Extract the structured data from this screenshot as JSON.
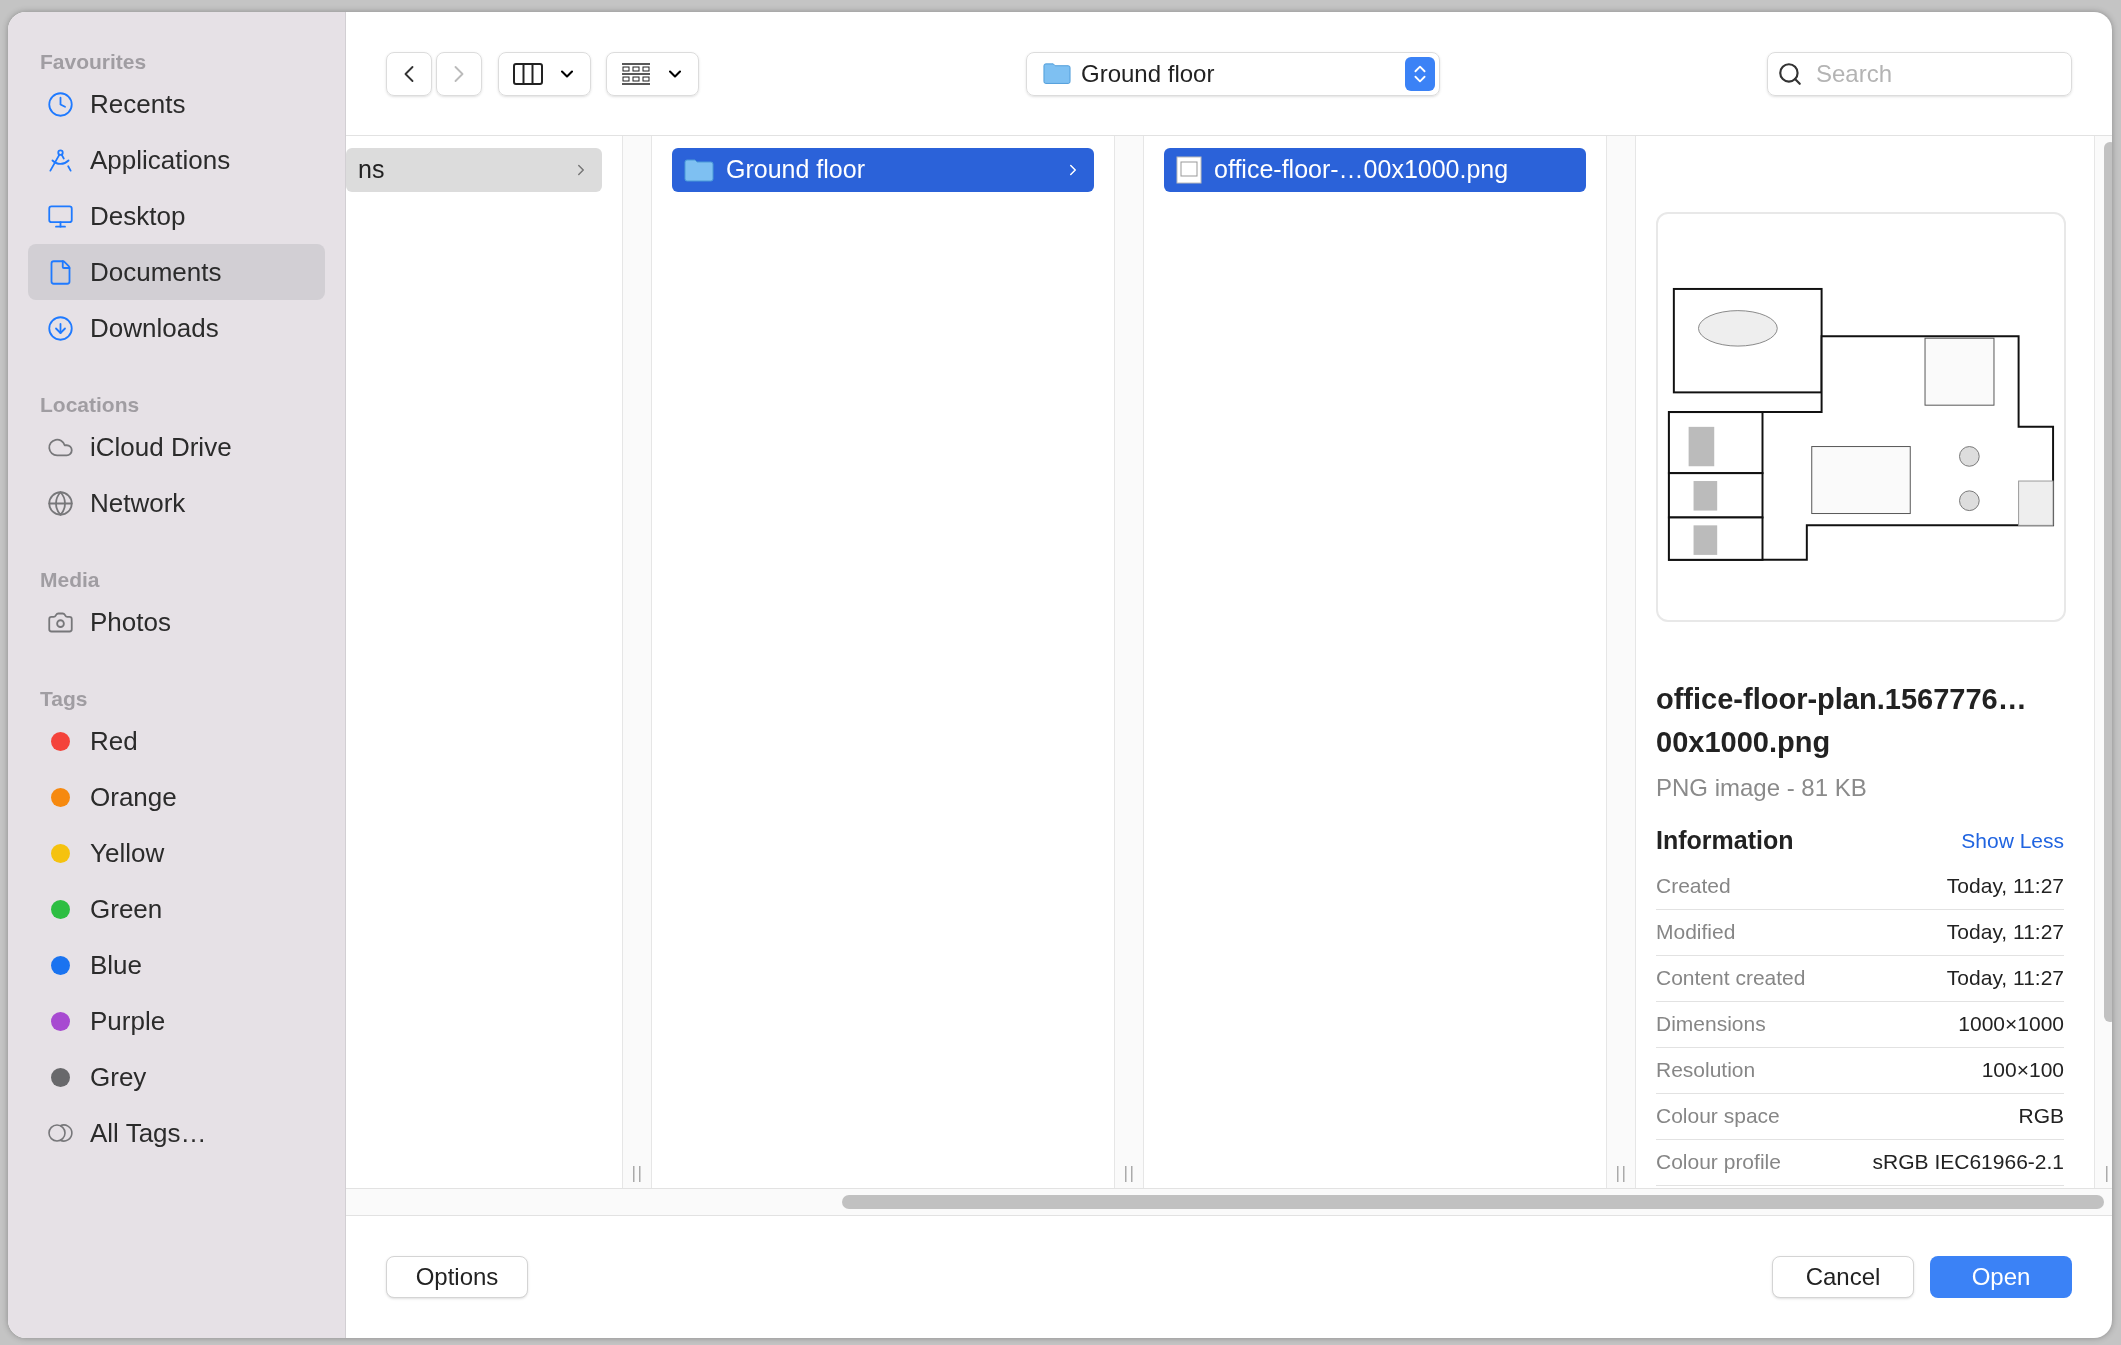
{
  "sidebar": {
    "sections": [
      {
        "title": "Favourites",
        "items": [
          {
            "label": "Recents",
            "kind": "place",
            "selected": false
          },
          {
            "label": "Applications",
            "kind": "place",
            "selected": false
          },
          {
            "label": "Desktop",
            "kind": "place",
            "selected": false
          },
          {
            "label": "Documents",
            "kind": "place",
            "selected": true
          },
          {
            "label": "Downloads",
            "kind": "place",
            "selected": false
          }
        ]
      },
      {
        "title": "Locations",
        "items": [
          {
            "label": "iCloud Drive",
            "kind": "place",
            "selected": false
          },
          {
            "label": "Network",
            "kind": "place",
            "selected": false
          }
        ]
      },
      {
        "title": "Media",
        "items": [
          {
            "label": "Photos",
            "kind": "place",
            "selected": false
          }
        ]
      },
      {
        "title": "Tags",
        "items": [
          {
            "label": "Red",
            "kind": "tag",
            "color": "#f4433b",
            "selected": false
          },
          {
            "label": "Orange",
            "kind": "tag",
            "color": "#f6890f",
            "selected": false
          },
          {
            "label": "Yellow",
            "kind": "tag",
            "color": "#f5c20f",
            "selected": false
          },
          {
            "label": "Green",
            "kind": "tag",
            "color": "#2dbe42",
            "selected": false
          },
          {
            "label": "Blue",
            "kind": "tag",
            "color": "#1a73f0",
            "selected": false
          },
          {
            "label": "Purple",
            "kind": "tag",
            "color": "#a74ad1",
            "selected": false
          },
          {
            "label": "Grey",
            "kind": "tag",
            "color": "#68686b",
            "selected": false
          },
          {
            "label": "All Tags…",
            "kind": "all",
            "selected": false
          }
        ]
      }
    ]
  },
  "toolbar": {
    "back": {
      "disabled": false
    },
    "forward": {
      "disabled": true
    },
    "path": "Ground floor",
    "search": {
      "placeholder": "Search"
    }
  },
  "columns": [
    {
      "items": [
        {
          "label": "ns",
          "kind": "folder_cut",
          "selected": true,
          "active": false
        }
      ]
    },
    {
      "items": [
        {
          "label": "Ground floor",
          "kind": "folder",
          "selected": true,
          "active": true
        }
      ]
    },
    {
      "items": [
        {
          "label": "office-floor-…00x1000.png",
          "kind": "file",
          "selected": true,
          "active": true
        }
      ]
    }
  ],
  "preview": {
    "kind": "picture",
    "title": "office-floor-plan.1567776…00x1000.png",
    "subtitle": "PNG image - 81 KB",
    "section": "Information",
    "toggle": "Show Less",
    "rows": [
      {
        "label": "Created",
        "value": "Today, 11:27"
      },
      {
        "label": "Modified",
        "value": "Today, 11:27"
      },
      {
        "label": "Content created",
        "value": "Today, 11:27"
      },
      {
        "label": "Dimensions",
        "value": "1000×1000"
      },
      {
        "label": "Resolution",
        "value": "100×100"
      },
      {
        "label": "Colour space",
        "value": "RGB"
      },
      {
        "label": "Colour profile",
        "value": "sRGB IEC61966-2.1"
      }
    ]
  },
  "buttons": [
    {
      "label": "Options",
      "kind": "secondary"
    },
    {
      "label": "Cancel",
      "kind": "secondary"
    },
    {
      "label": "Open",
      "kind": "primary"
    }
  ]
}
